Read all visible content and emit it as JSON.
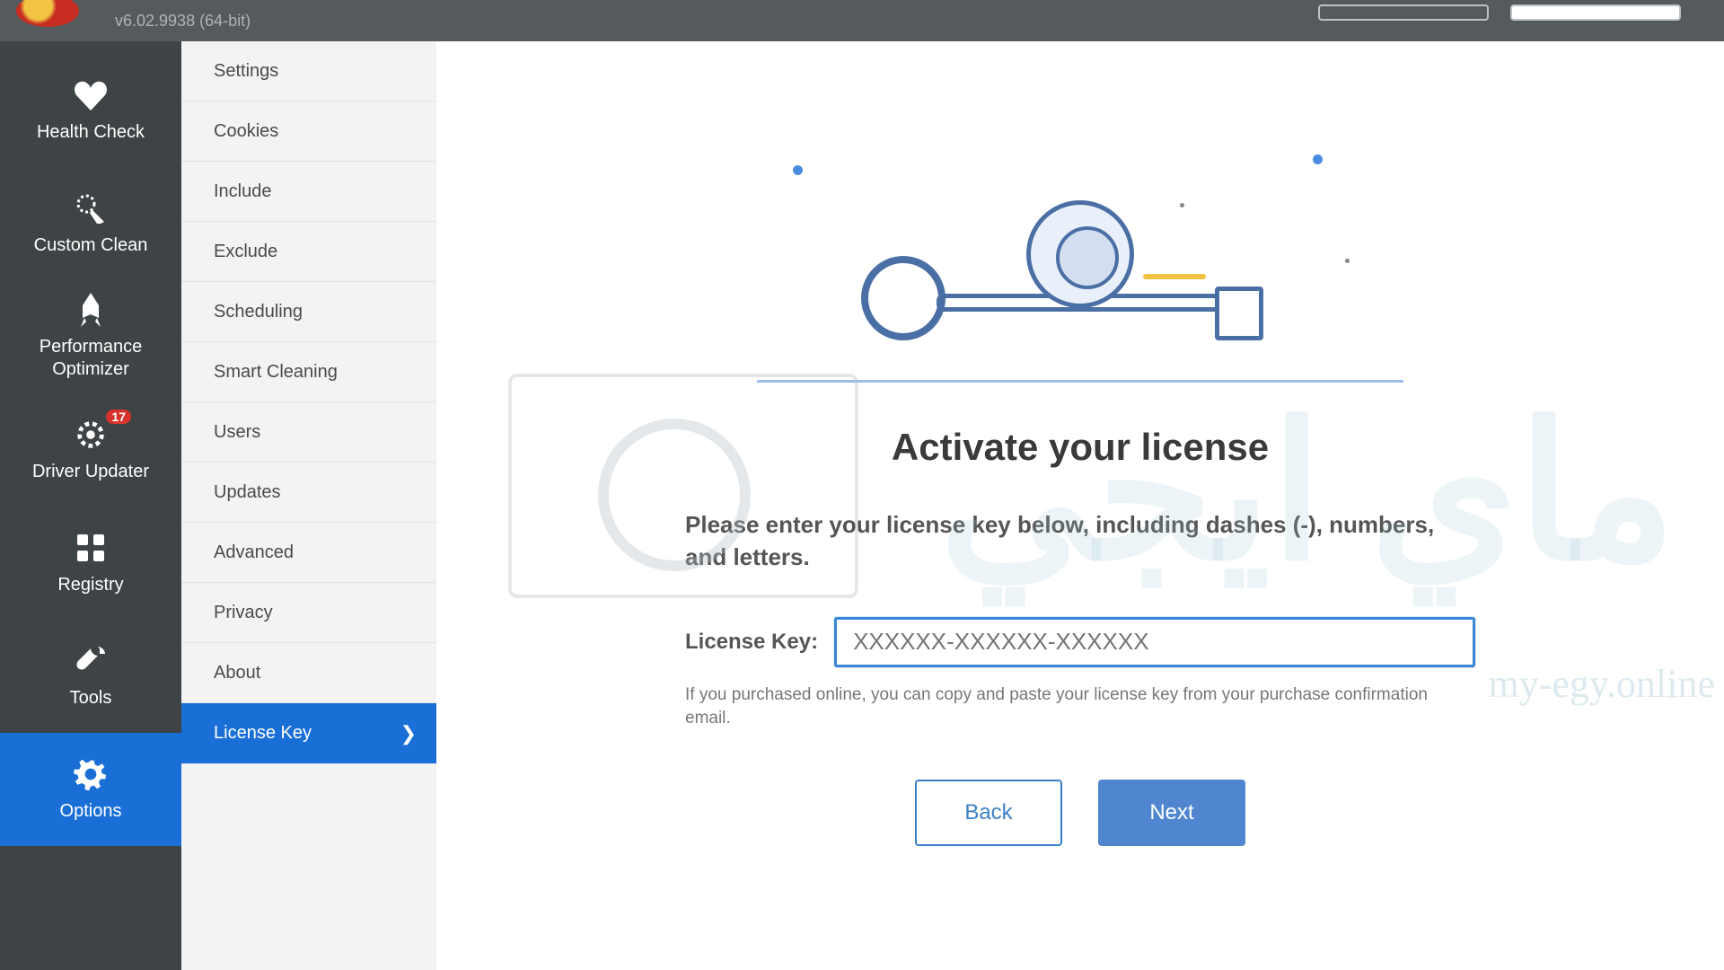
{
  "titlebar": {
    "version": "v6.02.9938 (64-bit)"
  },
  "primary_nav": {
    "items": [
      {
        "label": "Health Check"
      },
      {
        "label": "Custom Clean"
      },
      {
        "label": "Performance Optimizer"
      },
      {
        "label": "Driver Updater",
        "badge": "17"
      },
      {
        "label": "Registry"
      },
      {
        "label": "Tools"
      },
      {
        "label": "Options"
      }
    ]
  },
  "secondary_nav": {
    "items": [
      {
        "label": "Settings"
      },
      {
        "label": "Cookies"
      },
      {
        "label": "Include"
      },
      {
        "label": "Exclude"
      },
      {
        "label": "Scheduling"
      },
      {
        "label": "Smart Cleaning"
      },
      {
        "label": "Users"
      },
      {
        "label": "Updates"
      },
      {
        "label": "Advanced"
      },
      {
        "label": "Privacy"
      },
      {
        "label": "About"
      },
      {
        "label": "License Key"
      }
    ]
  },
  "content": {
    "heading": "Activate your license",
    "instruction": "Please enter your license key below, including dashes (-), numbers, and letters.",
    "key_label": "License Key:",
    "key_placeholder": "XXXXXX-XXXXXX-XXXXXX",
    "hint": "If you purchased online, you can copy and paste your license key from your purchase confirmation email.",
    "back_label": "Back",
    "next_label": "Next"
  },
  "watermark": {
    "text_ar": "ماي ايجي",
    "text_en": "my-egy.online"
  },
  "colors": {
    "accent": "#1a6fd6",
    "input_border": "#3b87d6"
  }
}
